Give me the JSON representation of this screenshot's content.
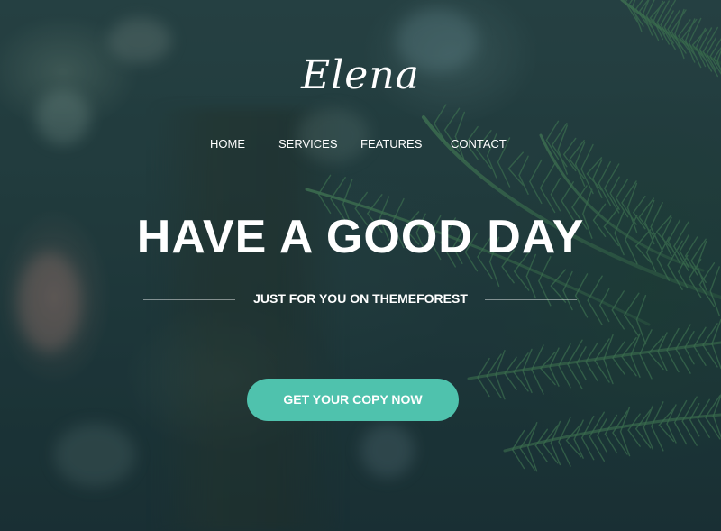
{
  "brand": {
    "logo": "Elena"
  },
  "nav": {
    "items": [
      {
        "label": "HOME"
      },
      {
        "label": "SERVICES"
      },
      {
        "label": "FEATURES"
      },
      {
        "label": "CONTACT"
      }
    ]
  },
  "hero": {
    "headline": "HAVE A GOOD DAY",
    "subtitle": "JUST FOR YOU ON THEMEFOREST",
    "cta_label": "GET YOUR COPY NOW",
    "background": "blurred forest with pine branches"
  },
  "colors": {
    "accent": "#4fc2ad",
    "text": "#ffffff",
    "background_dark": "#1f3a3c"
  }
}
